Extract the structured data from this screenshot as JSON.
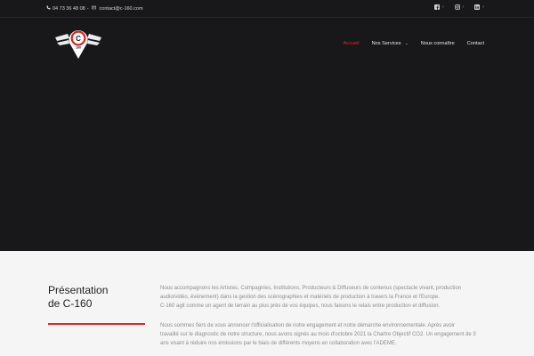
{
  "topbar": {
    "phone": "04 73 36 48 08",
    "separator": "-",
    "email": "contact@c-160.com",
    "socials": [
      {
        "icon": "facebook-icon",
        "chevron": "›"
      },
      {
        "icon": "instagram-icon",
        "chevron": "›"
      },
      {
        "icon": "linkedin-icon",
        "chevron": "›"
      }
    ]
  },
  "logo": {
    "text": "C",
    "number": "160"
  },
  "nav": {
    "items": [
      {
        "label": "Accueil",
        "active": true
      },
      {
        "label": "Nos Services",
        "dropdown": true,
        "caret": "⌄"
      },
      {
        "label": "Nous connaître"
      },
      {
        "label": "Contact"
      }
    ]
  },
  "presentation": {
    "title_line1": "Présentation",
    "title_line2": "de C-160",
    "paragraph1_line1": "Nous accompagnons les Artistes, Compagnies, Institutions, Producteurs & Diffuseurs de contenus (spectacle vivant, production",
    "paragraph1_line2": "audio/vidéo, événement) dans la gestion des scénographies et matériels de production à travers la France et l'Europe.",
    "paragraph1_line3": "C-160 agit comme un agent de terrain au plus près de vos équipes, nous faisons le relais entre production et diffusion.",
    "paragraph2_line1": "Nous sommes fiers de vous annoncer l'officialisation de notre engagement et notre démarche environnementale. Après avoir",
    "paragraph2_line2": "travaillé sur le diagnostic de notre structure, nous avons signés au mois d'octobre 2021 la Chartre Objectif CO2. Un engagement de 3",
    "paragraph2_line3": "ans visant à réduire nos émissions par le biais de différents moyens en collaboration avec l'ADEME."
  },
  "colors": {
    "hero_bg": "#18181b",
    "accent": "#d52a2a",
    "page_bg": "#f5f5f5"
  }
}
